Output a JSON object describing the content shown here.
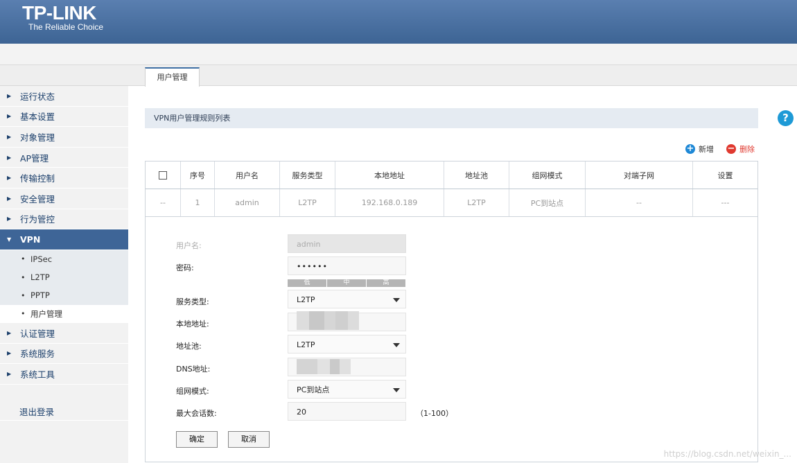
{
  "brand": {
    "logo": "TP-LINK",
    "tagline": "The Reliable Choice"
  },
  "tabs": [
    {
      "label": "用户管理"
    }
  ],
  "sidebar": {
    "items": [
      {
        "label": "运行状态"
      },
      {
        "label": "基本设置"
      },
      {
        "label": "对象管理"
      },
      {
        "label": "AP管理"
      },
      {
        "label": "传输控制"
      },
      {
        "label": "安全管理"
      },
      {
        "label": "行为管控"
      },
      {
        "label": "VPN",
        "expanded": true,
        "children": [
          {
            "label": "IPSec"
          },
          {
            "label": "L2TP"
          },
          {
            "label": "PPTP"
          },
          {
            "label": "用户管理",
            "selected": true
          }
        ]
      },
      {
        "label": "认证管理"
      },
      {
        "label": "系统服务"
      },
      {
        "label": "系统工具"
      }
    ],
    "logout": "退出登录"
  },
  "section": {
    "title": "VPN用户管理规则列表"
  },
  "help_icon": "?",
  "toolbar": {
    "add_label": "新增",
    "delete_label": "删除",
    "add_symbol": "+",
    "delete_symbol": "−"
  },
  "table": {
    "headers": [
      "序号",
      "用户名",
      "服务类型",
      "本地地址",
      "地址池",
      "组网模式",
      "对端子网",
      "设置"
    ],
    "rows": [
      {
        "checkbox": "--",
        "cells": [
          "1",
          "admin",
          "L2TP",
          "192.168.0.189",
          "L2TP",
          "PC到站点",
          "--",
          "---"
        ]
      }
    ]
  },
  "form": {
    "username_label": "用户名:",
    "username_value": "admin",
    "password_label": "密码:",
    "password_value": "••••••",
    "strength_low": "低",
    "strength_mid": "中",
    "strength_high": "高",
    "service_label": "服务类型:",
    "service_value": "L2TP",
    "local_label": "本地地址:",
    "pool_label": "地址池:",
    "pool_value": "L2TP",
    "dns_label": "DNS地址:",
    "mode_label": "组网模式:",
    "mode_value": "PC到站点",
    "max_label": "最大会话数:",
    "max_value": "20",
    "max_range": "（1-100）",
    "ok_label": "确定",
    "cancel_label": "取消"
  },
  "watermark": "https://blog.csdn.net/weixin_..."
}
